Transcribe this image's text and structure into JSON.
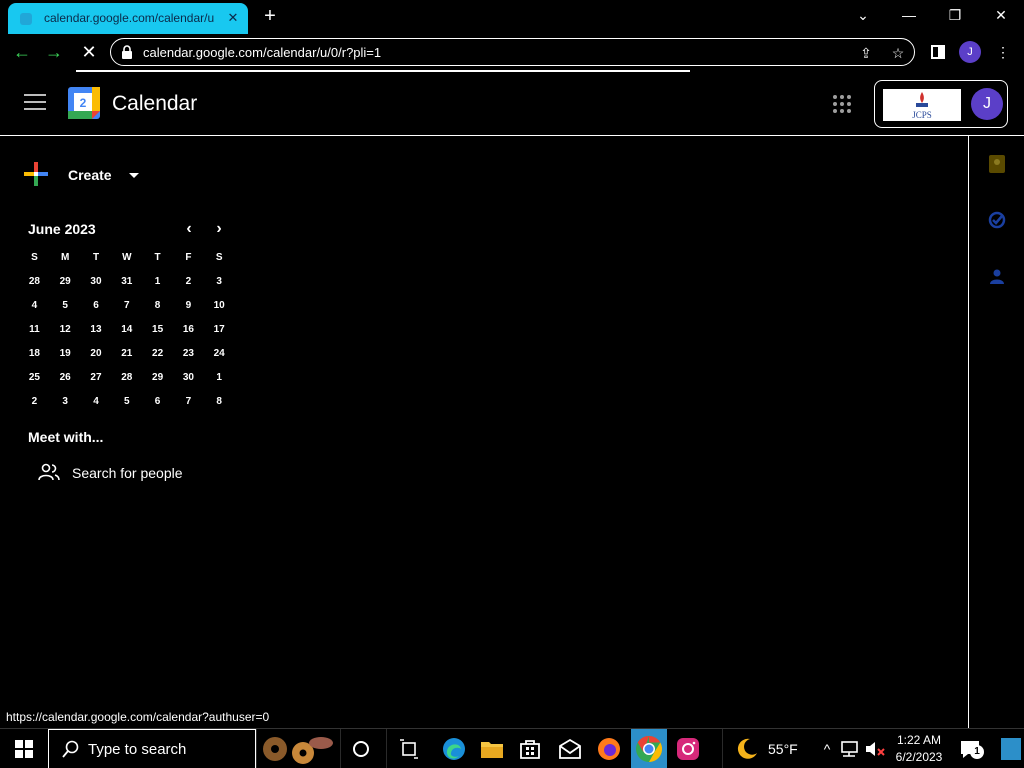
{
  "browser": {
    "tab_title": "calendar.google.com/calendar/u",
    "tab_close": "✕",
    "new_tab": "+",
    "url": "calendar.google.com/calendar/u/0/r?pli=1",
    "profile_initial": "J",
    "status_url": "https://calendar.google.com/calendar?authuser=0"
  },
  "header": {
    "logo_day": "2",
    "title": "Calendar",
    "account_initial": "J",
    "org_logo_text": "JCPS"
  },
  "sidebar": {
    "create_label": "Create",
    "mini_calendar": {
      "month": "June 2023",
      "weekdays": [
        "S",
        "M",
        "T",
        "W",
        "T",
        "F",
        "S"
      ],
      "weeks": [
        [
          "28",
          "29",
          "30",
          "31",
          "1",
          "2",
          "3"
        ],
        [
          "4",
          "5",
          "6",
          "7",
          "8",
          "9",
          "10"
        ],
        [
          "11",
          "12",
          "13",
          "14",
          "15",
          "16",
          "17"
        ],
        [
          "18",
          "19",
          "20",
          "21",
          "22",
          "23",
          "24"
        ],
        [
          "25",
          "26",
          "27",
          "28",
          "29",
          "30",
          "1"
        ],
        [
          "2",
          "3",
          "4",
          "5",
          "6",
          "7",
          "8"
        ]
      ]
    },
    "meet_title": "Meet with...",
    "search_people": "Search for people"
  },
  "taskbar": {
    "search_placeholder": "Type to search",
    "weather_temp": "55°F",
    "time": "1:22 AM",
    "date": "6/2/2023",
    "notification_count": "1"
  },
  "colors": {
    "tab_active": "#18c8f0",
    "nav_green": "#3dd65a",
    "avatar_purple": "#5b3fc8",
    "taskbar_active": "#2c8fc9"
  }
}
